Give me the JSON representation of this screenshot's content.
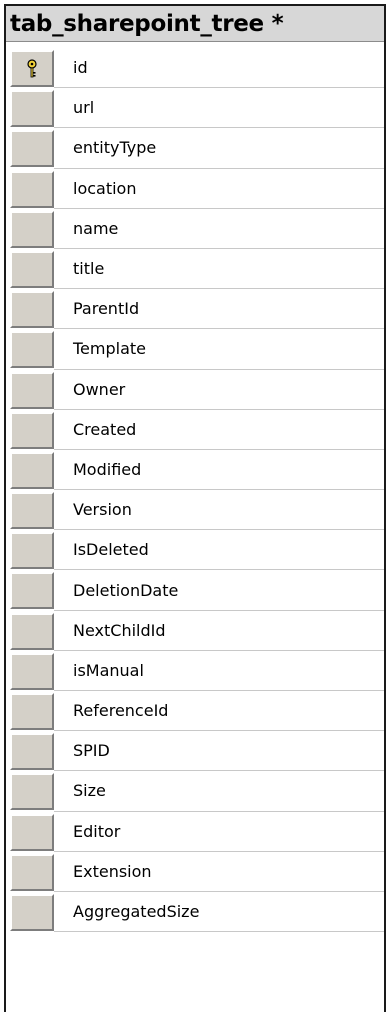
{
  "table": {
    "title": "tab_sharepoint_tree *",
    "columns": [
      {
        "name": "id",
        "primary_key": true
      },
      {
        "name": "url"
      },
      {
        "name": "entityType"
      },
      {
        "name": "location"
      },
      {
        "name": "name"
      },
      {
        "name": "title"
      },
      {
        "name": "ParentId"
      },
      {
        "name": "Template"
      },
      {
        "name": "Owner"
      },
      {
        "name": "Created"
      },
      {
        "name": "Modified"
      },
      {
        "name": "Version"
      },
      {
        "name": "IsDeleted"
      },
      {
        "name": "DeletionDate"
      },
      {
        "name": "NextChildId"
      },
      {
        "name": "isManual"
      },
      {
        "name": "ReferenceId"
      },
      {
        "name": "SPID"
      },
      {
        "name": "Size"
      },
      {
        "name": "Editor"
      },
      {
        "name": "Extension"
      },
      {
        "name": "AggregatedSize"
      }
    ],
    "key_icon": "primary-key-icon",
    "colors": {
      "title_bar": "#d7d7d7",
      "row_selector": "#d4d0c8",
      "key_fill": "#f2d23a"
    }
  }
}
